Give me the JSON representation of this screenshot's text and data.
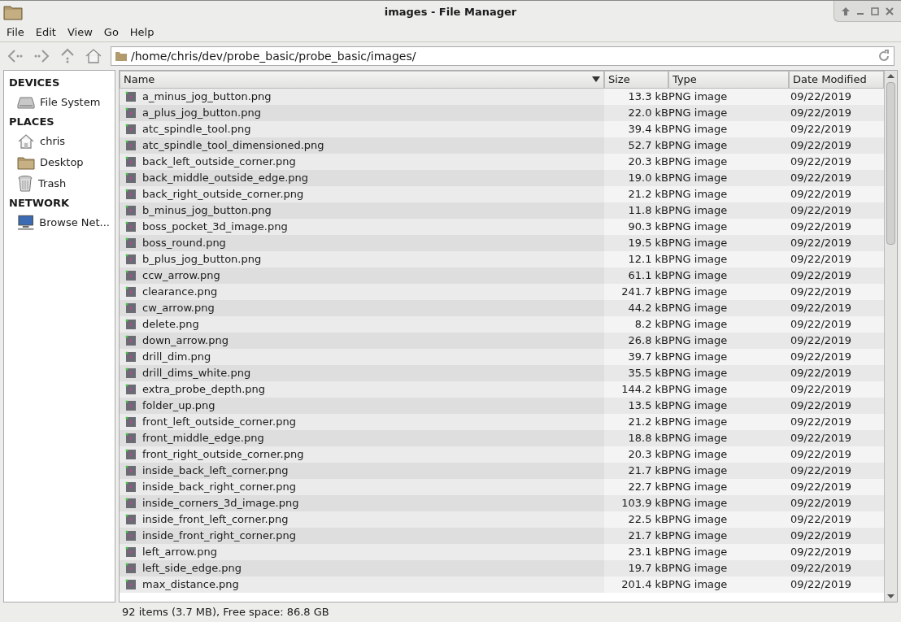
{
  "window": {
    "title": "images - File Manager"
  },
  "menu": [
    "File",
    "Edit",
    "View",
    "Go",
    "Help"
  ],
  "location": {
    "value": "/home/chris/dev/probe_basic/probe_basic/images/"
  },
  "sidebar": [
    {
      "heading": "DEVICES",
      "items": [
        {
          "label": "File System",
          "kind": "drive"
        }
      ]
    },
    {
      "heading": "PLACES",
      "items": [
        {
          "label": "chris",
          "kind": "home"
        },
        {
          "label": "Desktop",
          "kind": "folder"
        },
        {
          "label": "Trash",
          "kind": "trash"
        }
      ]
    },
    {
      "heading": "NETWORK",
      "items": [
        {
          "label": "Browse Net...",
          "kind": "network"
        }
      ]
    }
  ],
  "table": {
    "columns": [
      {
        "label": "Name",
        "sorted": true
      },
      {
        "label": "Size",
        "sorted": false
      },
      {
        "label": "Type",
        "sorted": false
      },
      {
        "label": "Date Modified",
        "sorted": false
      }
    ],
    "rows": [
      [
        "a_minus_jog_button.png",
        "13.3 kB",
        "PNG image",
        "09/22/2019"
      ],
      [
        "a_plus_jog_button.png",
        "22.0 kB",
        "PNG image",
        "09/22/2019"
      ],
      [
        "atc_spindle_tool.png",
        "39.4 kB",
        "PNG image",
        "09/22/2019"
      ],
      [
        "atc_spindle_tool_dimensioned.png",
        "52.7 kB",
        "PNG image",
        "09/22/2019"
      ],
      [
        "back_left_outside_corner.png",
        "20.3 kB",
        "PNG image",
        "09/22/2019"
      ],
      [
        "back_middle_outside_edge.png",
        "19.0 kB",
        "PNG image",
        "09/22/2019"
      ],
      [
        "back_right_outside_corner.png",
        "21.2 kB",
        "PNG image",
        "09/22/2019"
      ],
      [
        "b_minus_jog_button.png",
        "11.8 kB",
        "PNG image",
        "09/22/2019"
      ],
      [
        "boss_pocket_3d_image.png",
        "90.3 kB",
        "PNG image",
        "09/22/2019"
      ],
      [
        "boss_round.png",
        "19.5 kB",
        "PNG image",
        "09/22/2019"
      ],
      [
        "b_plus_jog_button.png",
        "12.1 kB",
        "PNG image",
        "09/22/2019"
      ],
      [
        "ccw_arrow.png",
        "61.1 kB",
        "PNG image",
        "09/22/2019"
      ],
      [
        "clearance.png",
        "241.7 kB",
        "PNG image",
        "09/22/2019"
      ],
      [
        "cw_arrow.png",
        "44.2 kB",
        "PNG image",
        "09/22/2019"
      ],
      [
        "delete.png",
        "8.2 kB",
        "PNG image",
        "09/22/2019"
      ],
      [
        "down_arrow.png",
        "26.8 kB",
        "PNG image",
        "09/22/2019"
      ],
      [
        "drill_dim.png",
        "39.7 kB",
        "PNG image",
        "09/22/2019"
      ],
      [
        "drill_dims_white.png",
        "35.5 kB",
        "PNG image",
        "09/22/2019"
      ],
      [
        "extra_probe_depth.png",
        "144.2 kB",
        "PNG image",
        "09/22/2019"
      ],
      [
        "folder_up.png",
        "13.5 kB",
        "PNG image",
        "09/22/2019"
      ],
      [
        "front_left_outside_corner.png",
        "21.2 kB",
        "PNG image",
        "09/22/2019"
      ],
      [
        "front_middle_edge.png",
        "18.8 kB",
        "PNG image",
        "09/22/2019"
      ],
      [
        "front_right_outside_corner.png",
        "20.3 kB",
        "PNG image",
        "09/22/2019"
      ],
      [
        "inside_back_left_corner.png",
        "21.7 kB",
        "PNG image",
        "09/22/2019"
      ],
      [
        "inside_back_right_corner.png",
        "22.7 kB",
        "PNG image",
        "09/22/2019"
      ],
      [
        "inside_corners_3d_image.png",
        "103.9 kB",
        "PNG image",
        "09/22/2019"
      ],
      [
        "inside_front_left_corner.png",
        "22.5 kB",
        "PNG image",
        "09/22/2019"
      ],
      [
        "inside_front_right_corner.png",
        "21.7 kB",
        "PNG image",
        "09/22/2019"
      ],
      [
        "left_arrow.png",
        "23.1 kB",
        "PNG image",
        "09/22/2019"
      ],
      [
        "left_side_edge.png",
        "19.7 kB",
        "PNG image",
        "09/22/2019"
      ],
      [
        "max_distance.png",
        "201.4 kB",
        "PNG image",
        "09/22/2019"
      ]
    ]
  },
  "status_bar": "92 items (3.7 MB), Free space: 86.8 GB"
}
